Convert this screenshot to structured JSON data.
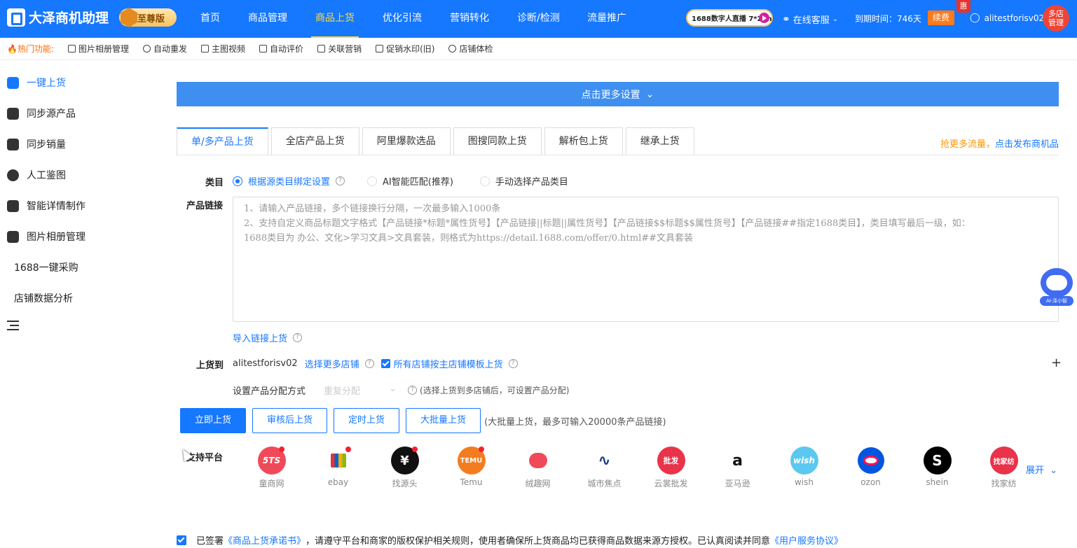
{
  "header": {
    "app_name": "大泽商机助理",
    "edition": "至尊版",
    "nav": [
      "首页",
      "商品管理",
      "商品上货",
      "优化引流",
      "营销转化",
      "诊断/检测",
      "流量推广"
    ],
    "active_nav": "商品上货",
    "live_badge": "1688数字人直播 7*24h",
    "service": "在线客服",
    "expire": "到期时间：746天",
    "renew": "续费",
    "hui": "惠",
    "username": "alitestforisv02",
    "multi_store": [
      "多店",
      "管理"
    ]
  },
  "hotbar": {
    "label": "热门功能:",
    "items": [
      "图片相册管理",
      "自动重发",
      "主图视频",
      "自动评价",
      "关联营销",
      "促销水印(旧)",
      "店铺体检"
    ]
  },
  "sidebar": {
    "items": [
      {
        "label": "一键上货",
        "icon": "document-icon",
        "active": true
      },
      {
        "label": "同步源产品",
        "icon": "sync-icon"
      },
      {
        "label": "同步销量",
        "icon": "sync-icon"
      },
      {
        "label": "人工鉴图",
        "icon": "search-icon"
      },
      {
        "label": "智能详情制作",
        "icon": "list-icon"
      },
      {
        "label": "图片相册管理",
        "icon": "image-icon"
      }
    ],
    "plain_items": [
      "1688一键采购",
      "店铺数据分析"
    ]
  },
  "main": {
    "more_settings": "点击更多设置",
    "tabs": [
      "单/多产品上货",
      "全店产品上货",
      "阿里爆款选品",
      "图搜同款上货",
      "解析包上货",
      "继承上货"
    ],
    "promo_orange": "抢更多流量，",
    "promo_blue": "点击发布商机品",
    "category_label": "类目",
    "category_options": [
      "根据源类目绑定设置",
      "AI智能匹配(推荐)",
      "手动选择产品类目"
    ],
    "link_label": "产品链接",
    "link_placeholder_1": "1、请输入产品链接，多个链接换行分隔，一次最多输入1000条",
    "link_placeholder_2": "2、支持自定义商品标题文字格式【产品链接*标题*属性货号】【产品链接||标题||属性货号】【产品链接$$标题$$属性货号】【产品链接##指定1688类目】，类目填写最后一级，如：",
    "link_placeholder_3": "1688类目为 办公、文化>学习文具>文具套装，则格式为https://detail.1688.com/offer/0.html##文具套装",
    "import_link": "导入链接上货",
    "upload_to_label": "上货到",
    "shop_name": "alitestforisv02",
    "choose_more": "选择更多店铺",
    "template_check": "所有店铺按主店铺模板上货",
    "dist_label": "设置产品分配方式",
    "dist_select": "重复分配",
    "dist_hint": "(选择上货到多店铺后，可设置产品分配)",
    "buttons": [
      "立即上货",
      "审核后上货",
      "定时上货",
      "大批量上货"
    ],
    "bulk_hint": "(大批量上货，最多可输入20000条产品链接)",
    "platform_label": "支持平台",
    "platforms": [
      {
        "name": "童商网",
        "icon_text": "5TS",
        "color": "#f04a5a",
        "dot": true
      },
      {
        "name": "ebay",
        "icon_text": "",
        "color": "#ffffff",
        "dot": true
      },
      {
        "name": "找源头",
        "icon_text": "¥",
        "color": "#111111",
        "dot": true
      },
      {
        "name": "Temu",
        "icon_text": "TEMU",
        "color": "#f47c20",
        "dot": true
      },
      {
        "name": "绒趣网",
        "icon_text": "",
        "color": "#ffffff",
        "dot": false
      },
      {
        "name": "城市焦点",
        "icon_text": "",
        "color": "#ffffff",
        "dot": false
      },
      {
        "name": "云裳批发",
        "icon_text": "批发",
        "color": "#e8334a",
        "dot": false
      },
      {
        "name": "亚马逊",
        "icon_text": "a",
        "color": "#ffffff",
        "dot": false
      },
      {
        "name": "wish",
        "icon_text": "wish",
        "color": "#5bc8f0",
        "dot": false
      },
      {
        "name": "ozon",
        "icon_text": "",
        "color": "#ffffff",
        "dot": false
      },
      {
        "name": "shein",
        "icon_text": "S",
        "color": "#000000",
        "dot": false
      },
      {
        "name": "找家纺",
        "icon_text": "找家纺",
        "color": "#e8334a",
        "dot": false
      }
    ],
    "expand": "展开",
    "agree_pre": "已签署",
    "agree_link1": "《商品上货承诺书》",
    "agree_mid": "，请遵守平台和商家的版权保护相关规则，使用者确保所上货商品均已获得商品数据来源方授权。已认真阅读并同意",
    "agree_link2": "《用户服务协议》"
  },
  "ai_bot_label": "AI·泽小智"
}
